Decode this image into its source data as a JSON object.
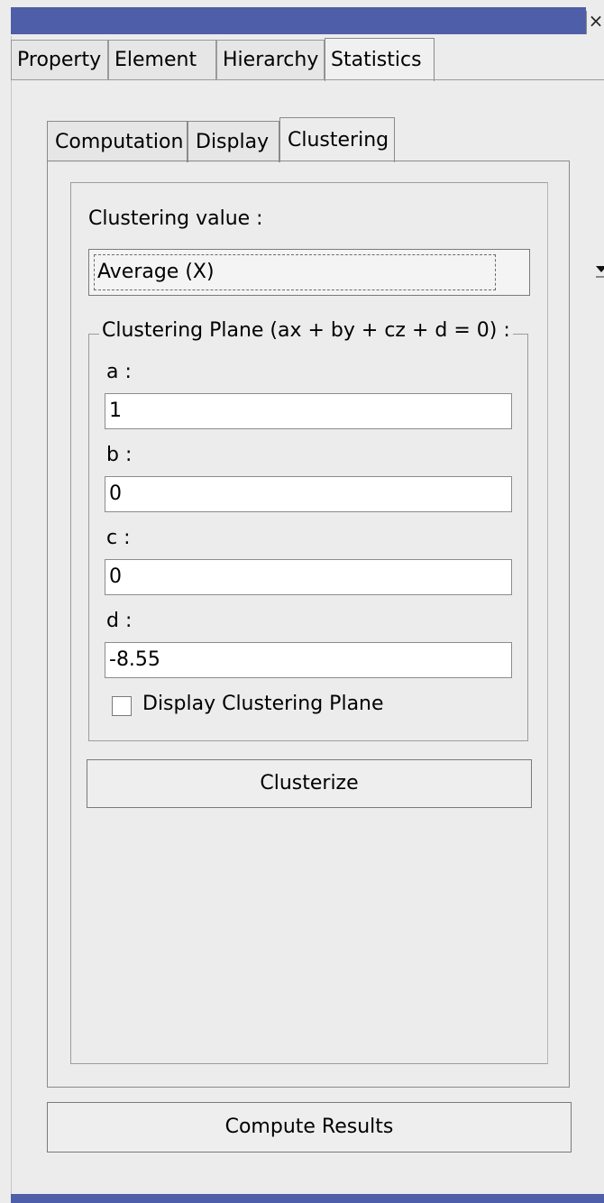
{
  "window": {
    "close_glyph": "×"
  },
  "tabs": [
    "Property",
    "Element",
    "Hierarchy",
    "Statistics"
  ],
  "subtabs": [
    "Computation",
    "Display",
    "Clustering"
  ],
  "clustering": {
    "value_label": "Clustering value :",
    "selected_value": "Average (X)",
    "plane_title": "Clustering Plane (ax + by + cz + d = 0) :",
    "fields": [
      {
        "label": "a :",
        "value": "1"
      },
      {
        "label": "b :",
        "value": "0"
      },
      {
        "label": "c :",
        "value": "0"
      },
      {
        "label": "d :",
        "value": "-8.55"
      }
    ],
    "display_plane_label": "Display Clustering Plane",
    "display_plane_checked": false,
    "clusterize_label": "Clusterize"
  },
  "compute_label": "Compute Results",
  "icons": {
    "close": "close-icon",
    "dropdown": "chevron-down-icon",
    "checkbox": "checkbox-icon"
  },
  "colors": {
    "titlebar": "#4f5ea8",
    "background": "#ececec"
  }
}
